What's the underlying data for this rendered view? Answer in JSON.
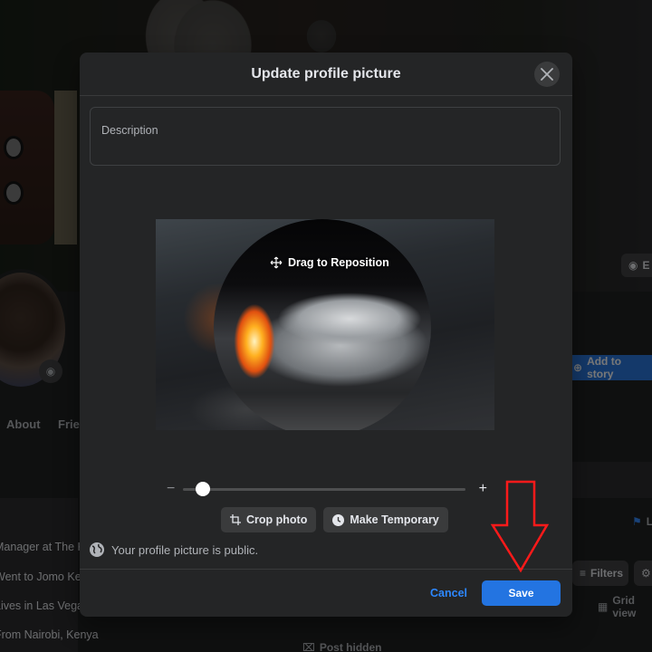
{
  "background_page": {
    "nav_tabs": [
      "About",
      "Friends"
    ],
    "intro_lines": [
      "Manager at The Krusty",
      "Went to Jomo Kenyatta",
      "Lives in Las Vegas, Nevada",
      "From Nairobi, Kenya"
    ],
    "edit_cover_label": "E",
    "add_to_story_label": "Add to story",
    "filters_label": "Filters",
    "grid_view_label": "Grid view",
    "post_hidden_label": "Post hidden",
    "life_event_label": "L"
  },
  "modal": {
    "title": "Update profile picture",
    "close_icon": "close-icon",
    "description_placeholder": "Description",
    "drag_hint": "Drag to Reposition",
    "zoom": {
      "minus": "−",
      "plus": "+",
      "value_fraction": 0.07
    },
    "actions": [
      {
        "icon": "crop-icon",
        "label": "Crop photo"
      },
      {
        "icon": "clock-icon",
        "label": "Make Temporary"
      }
    ],
    "privacy_text": "Your profile picture is public.",
    "cancel_label": "Cancel",
    "save_label": "Save"
  },
  "colors": {
    "accent": "#2374e1",
    "link": "#2d88ff",
    "modal_bg": "#242526",
    "annotation": "#ff1a1a"
  }
}
